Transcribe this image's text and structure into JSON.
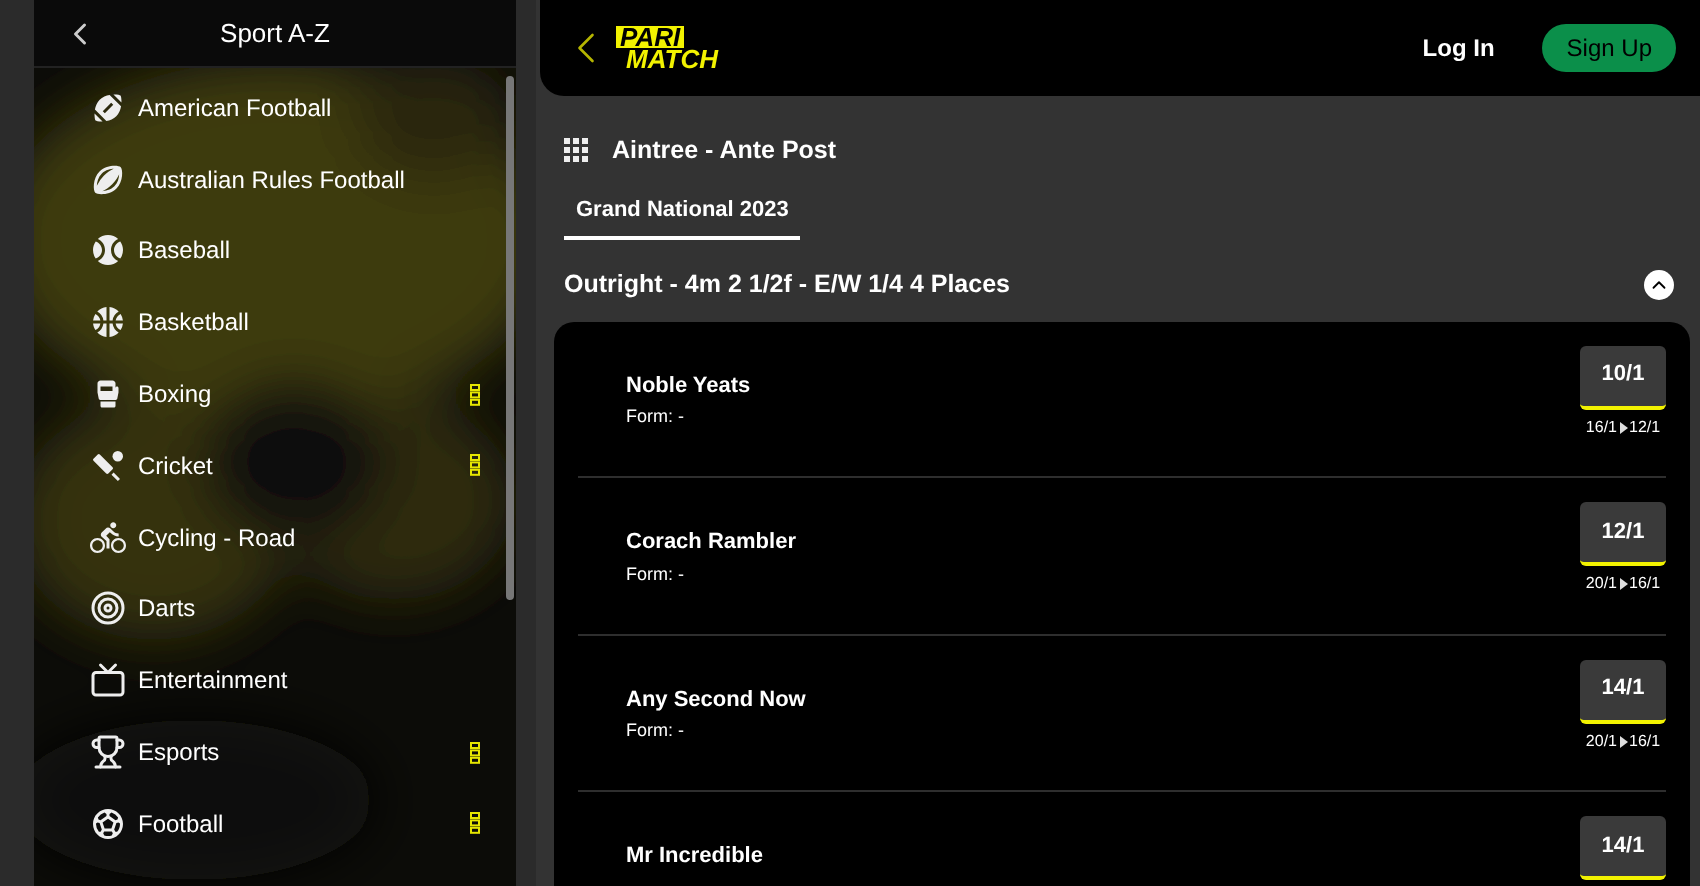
{
  "sidebar": {
    "title": "Sport A-Z",
    "items": [
      {
        "label": "American Football",
        "live": false
      },
      {
        "label": "Australian Rules Football",
        "live": false
      },
      {
        "label": "Baseball",
        "live": false
      },
      {
        "label": "Basketball",
        "live": false
      },
      {
        "label": "Boxing",
        "live": true
      },
      {
        "label": "Cricket",
        "live": true
      },
      {
        "label": "Cycling - Road",
        "live": false
      },
      {
        "label": "Darts",
        "live": false
      },
      {
        "label": "Entertainment",
        "live": false
      },
      {
        "label": "Esports",
        "live": true
      },
      {
        "label": "Football",
        "live": true
      }
    ]
  },
  "header": {
    "logo": [
      "PARI",
      "MATCH"
    ],
    "login": "Log In",
    "signup": "Sign Up"
  },
  "event": {
    "title": "Aintree - Ante Post",
    "tabs": [
      {
        "label": "Grand National 2023",
        "selected": true
      }
    ],
    "market": {
      "title": "Outright - 4m 2 1/2f - E/W 1/4 4 Places",
      "expanded": true
    },
    "runners": [
      {
        "name": "Noble Yeats",
        "form": "Form: -",
        "odds": "10/1",
        "from": "16/1",
        "to": "12/1"
      },
      {
        "name": "Corach Rambler",
        "form": "Form: -",
        "odds": "12/1",
        "from": "20/1",
        "to": "16/1"
      },
      {
        "name": "Any Second Now",
        "form": "Form: -",
        "odds": "14/1",
        "from": "20/1",
        "to": "16/1"
      },
      {
        "name": "Mr Incredible",
        "odds": "14/1"
      }
    ]
  }
}
